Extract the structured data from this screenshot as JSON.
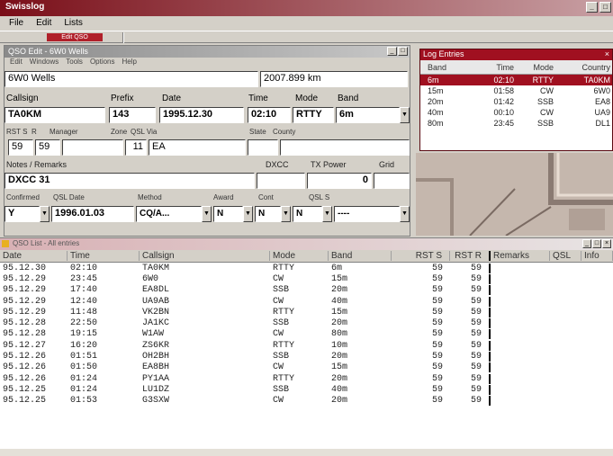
{
  "app": {
    "title": "Swisslog"
  },
  "menu": [
    "File",
    "Edit",
    "Lists"
  ],
  "toolbar": {
    "tab_label": "Edit QSO"
  },
  "edit_window": {
    "title": "QSO Edit - 6W0 Wells",
    "menu": [
      "Edit",
      "Windows",
      "Tools",
      "Options",
      "Help"
    ],
    "station_name": "6W0 Wells",
    "distance": "2007.899 km",
    "labels": {
      "callsign": "Callsign",
      "prefix": "Prefix",
      "date": "Date",
      "time": "Time",
      "mode": "Mode",
      "band": "Band",
      "rst_sent": "RST S",
      "rst_rcvd": "R",
      "manager": "Manager",
      "zone": "Zone",
      "qsl_via": "QSL Via",
      "state": "State",
      "county": "County",
      "notes": "Notes / Remarks",
      "dxcc": "DXCC",
      "tx_power": "TX Power",
      "grid": "Grid",
      "confirm": "Confirmed",
      "qsl_date": "QSL Date",
      "method": "Method",
      "award": "Award",
      "s": "S",
      "r": "R",
      "cont": "Cont",
      "qsl_s": "QSL S"
    },
    "callsign": "TA0KM",
    "prefix": "143",
    "date": "1995.12.30",
    "time": "02:10",
    "mode": "RTTY",
    "band": "6m",
    "rst_s": "59",
    "rst_r": "59",
    "manager": "",
    "zone": "11",
    "qsl_via": "EA",
    "state": "",
    "county": "",
    "notes": "DXCC 31",
    "dxcc": "",
    "tx_power": "0",
    "grid": "",
    "confirm": "Y",
    "qsl_date": "1996.01.03",
    "method": "CQ/A...",
    "s": "N",
    "r": "N",
    "cont": "N",
    "qsl_s": "----"
  },
  "log_window": {
    "title": "Log Entries",
    "headers": [
      "Band",
      "Time",
      "Mode",
      "Country"
    ],
    "rows": [
      [
        "6m",
        "02:10",
        "RTTY",
        "TA0KM"
      ],
      [
        "15m",
        "01:58",
        "CW",
        "6W0"
      ],
      [
        "20m",
        "01:42",
        "SSB",
        "EA8"
      ],
      [
        "40m",
        "00:10",
        "CW",
        "UA9"
      ],
      [
        "80m",
        "23:45",
        "SSB",
        "DL1"
      ]
    ]
  },
  "list_window": {
    "title": "QSO List - All entries",
    "headers": [
      "Date",
      "Time",
      "Callsign",
      "Mode",
      "Band",
      "RST S",
      "RST R",
      "Remarks",
      "QSL",
      "Info"
    ],
    "rows": [
      [
        "95.12.30",
        "02:10",
        "TA0KM",
        "RTTY",
        "6m",
        "59",
        "59",
        "",
        "",
        ""
      ],
      [
        "95.12.29",
        "23:45",
        "6W0",
        "CW",
        "15m",
        "59",
        "59",
        "",
        "",
        ""
      ],
      [
        "95.12.29",
        "17:40",
        "EA8DL",
        "SSB",
        "20m",
        "59",
        "59",
        "",
        "",
        ""
      ],
      [
        "95.12.29",
        "12:40",
        "UA9AB",
        "CW",
        "40m",
        "59",
        "59",
        "",
        "",
        ""
      ],
      [
        "95.12.29",
        "11:48",
        "VK2BN",
        "RTTY",
        "15m",
        "59",
        "59",
        "",
        "",
        ""
      ],
      [
        "95.12.28",
        "22:50",
        "JA1KC",
        "SSB",
        "20m",
        "59",
        "59",
        "",
        "",
        ""
      ],
      [
        "95.12.28",
        "19:15",
        "W1AW",
        "CW",
        "80m",
        "59",
        "59",
        "",
        "",
        ""
      ],
      [
        "95.12.27",
        "16:20",
        "ZS6KR",
        "RTTY",
        "10m",
        "59",
        "59",
        "",
        "",
        ""
      ],
      [
        "95.12.26",
        "01:51",
        "OH2BH",
        "SSB",
        "20m",
        "59",
        "59",
        "",
        "",
        ""
      ],
      [
        "95.12.26",
        "01:50",
        "EA8BH",
        "CW",
        "15m",
        "59",
        "59",
        "",
        "",
        ""
      ],
      [
        "95.12.26",
        "01:24",
        "PY1AA",
        "RTTY",
        "20m",
        "59",
        "59",
        "",
        "",
        ""
      ],
      [
        "95.12.25",
        "01:24",
        "LU1DZ",
        "SSB",
        "40m",
        "59",
        "59",
        "",
        "",
        ""
      ],
      [
        "95.12.25",
        "01:53",
        "G3SXW",
        "CW",
        "20m",
        "59",
        "59",
        "",
        "",
        ""
      ]
    ]
  }
}
